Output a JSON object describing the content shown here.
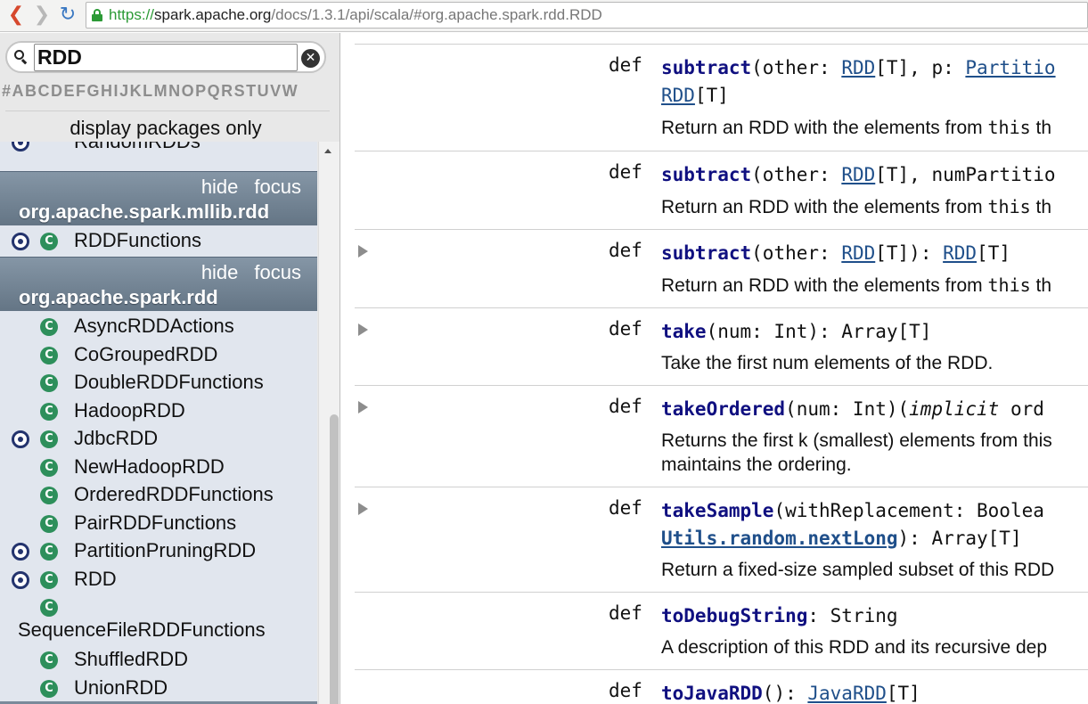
{
  "browser": {
    "url_scheme": "https://",
    "url_host": "spark.apache.org",
    "url_path": "/docs/1.3.1/api/scala/#org.apache.spark.rdd.RDD"
  },
  "sidebar": {
    "search_value": "RDD",
    "letters": [
      "#",
      "A",
      "B",
      "C",
      "D",
      "E",
      "F",
      "G",
      "H",
      "I",
      "J",
      "K",
      "L",
      "M",
      "N",
      "O",
      "P",
      "Q",
      "R",
      "S",
      "T",
      "U",
      "V",
      "W"
    ],
    "display_packages_only": "display packages only",
    "partial_item": "RandomRDDs",
    "packages": [
      {
        "hide": "hide",
        "focus": "focus",
        "name": "org.apache.spark.mllib.rdd",
        "items": [
          {
            "label": "RDDFunctions",
            "object": true,
            "class": true
          }
        ]
      },
      {
        "hide": "hide",
        "focus": "focus",
        "name": "org.apache.spark.rdd",
        "items": [
          {
            "label": "AsyncRDDActions",
            "object": false,
            "class": true
          },
          {
            "label": "CoGroupedRDD",
            "object": false,
            "class": true
          },
          {
            "label": "DoubleRDDFunctions",
            "object": false,
            "class": true
          },
          {
            "label": "HadoopRDD",
            "object": false,
            "class": true
          },
          {
            "label": "JdbcRDD",
            "object": true,
            "class": true
          },
          {
            "label": "NewHadoopRDD",
            "object": false,
            "class": true
          },
          {
            "label": "OrderedRDDFunctions",
            "object": false,
            "class": true
          },
          {
            "label": "PairRDDFunctions",
            "object": false,
            "class": true
          },
          {
            "label": "PartitionPruningRDD",
            "object": true,
            "class": true
          },
          {
            "label": "RDD",
            "object": true,
            "class": true
          },
          {
            "label": "SequenceFileRDDFunctions",
            "object": false,
            "class": true
          },
          {
            "label": "ShuffledRDD",
            "object": false,
            "class": true
          },
          {
            "label": "UnionRDD",
            "object": false,
            "class": true
          }
        ]
      }
    ]
  },
  "members": [
    {
      "kw": "def",
      "name": "subtract",
      "sig_rest1": "(other: ",
      "type1": "RDD",
      "sig_rest2": "[T], p: ",
      "type2": "Partitio",
      "line2_type": "RDD",
      "line2_rest": "[T]",
      "desc": "Return an RDD with the elements from ",
      "desc_mono": "this",
      "desc_tail": " th"
    },
    {
      "kw": "def",
      "name": "subtract",
      "sig_rest1": "(other: ",
      "type1": "RDD",
      "sig_rest2": "[T], numPartitio",
      "desc": "Return an RDD with the elements from ",
      "desc_mono": "this",
      "desc_tail": " th"
    },
    {
      "kw": "def",
      "name": "subtract",
      "sig_rest1": "(other: ",
      "type1": "RDD",
      "sig_rest2": "[T]): ",
      "type2": "RDD",
      "sig_rest3": "[T]",
      "desc": "Return an RDD with the elements from ",
      "desc_mono": "this",
      "desc_tail": " th"
    },
    {
      "kw": "def",
      "name": "take",
      "sig_rest1": "(num: Int): Array[T]",
      "desc": "Take the first num elements of the RDD."
    },
    {
      "kw": "def",
      "name": "takeOrdered",
      "sig_rest1": "(num: Int)(",
      "ital": "implicit",
      "sig_rest2": " ord",
      "desc": "Returns the first k (smallest) elements from this",
      "desc_line2": "maintains the ordering."
    },
    {
      "kw": "def",
      "name": "takeSample",
      "sig_rest1": "(withReplacement: Boolea",
      "line2_name": "Utils.random.nextLong",
      "line2_rest": "): Array[T]",
      "desc": "Return a fixed-size sampled subset of this RDD"
    },
    {
      "kw": "def",
      "name": "toDebugString",
      "sig_rest1": ": String",
      "desc": "A description of this RDD and its recursive dep"
    },
    {
      "kw": "def",
      "name": "toJavaRDD",
      "sig_rest1": "(): ",
      "type1": "JavaRDD",
      "sig_rest2": "[T]"
    }
  ]
}
